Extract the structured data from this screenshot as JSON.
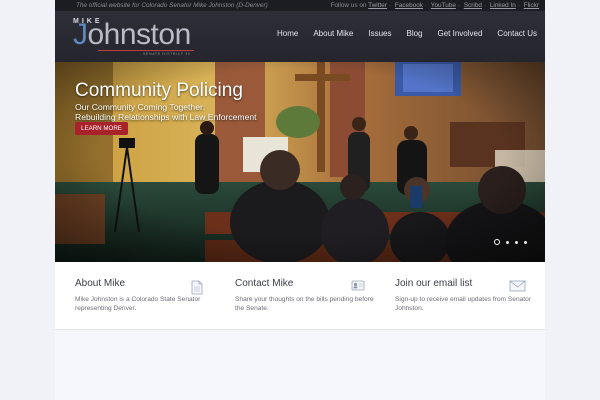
{
  "topbar": {
    "tagline": "The official website for Colorado Senator Mike Johnston (D-Denver)",
    "follow_label": "Follow us on",
    "social": [
      "Twitter",
      "Facebook",
      "YouTube",
      "Scribd",
      "Linked In",
      "Flickr"
    ]
  },
  "logo": {
    "first_name": "MIKE",
    "last_name": "Johnston",
    "subtitle": "SENATE DISTRICT 33"
  },
  "nav": [
    "Home",
    "About Mike",
    "Issues",
    "Blog",
    "Get Involved",
    "Contact Us"
  ],
  "hero": {
    "title": "Community Policing",
    "subtitle_line1": "Our Community Coming Together:",
    "subtitle_line2": "Rebuilding Relationships with Law Enforcement",
    "button_label": "LEARN MORE",
    "slide_count": 4,
    "active_slide": 1
  },
  "features": [
    {
      "title": "About Mike",
      "text": "Mike Johnston is a Colorado State Senator representing Denver.",
      "icon": "document-icon"
    },
    {
      "title": "Contact Mike",
      "text": "Share your thoughts on the bills pending before the Senate.",
      "icon": "contact-card-icon"
    },
    {
      "title": "Join our email list",
      "text": "Sign-up to receive email updates from Senator Johnston.",
      "icon": "envelope-icon"
    }
  ],
  "colors": {
    "accent_red": "#a8212b",
    "logo_blue": "#5d87bf",
    "header_bg": "#2d2e36"
  }
}
